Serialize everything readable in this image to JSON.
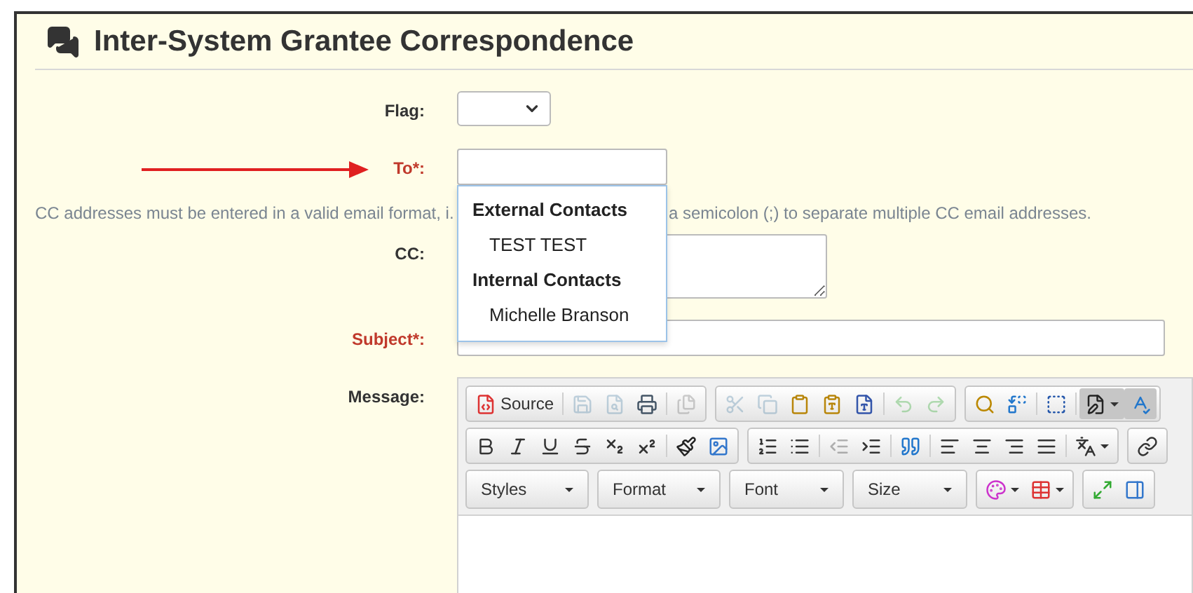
{
  "page": {
    "title": "Inter-System Grantee Correspondence"
  },
  "fields": [
    {
      "kind": "select",
      "label": "Flag:",
      "required": false
    },
    {
      "kind": "combo",
      "label": "To*:",
      "required": true,
      "pointer": true,
      "expanded": true,
      "options": [
        {
          "kind": "group",
          "label": "External Contacts"
        },
        {
          "kind": "option",
          "label": "TEST TEST"
        },
        {
          "kind": "group",
          "label": "Internal Contacts"
        },
        {
          "kind": "option",
          "label": "Michelle Branson"
        }
      ]
    },
    {
      "kind": "hint",
      "parts": [
        "CC addresses must be entered in a valid email format, i.",
        "a semicolon (;) to separate multiple CC email addresses."
      ]
    },
    {
      "kind": "textarea",
      "label": "CC:",
      "required": false
    },
    {
      "kind": "input",
      "label": "Subject*:",
      "required": true
    },
    {
      "kind": "editor",
      "label": "Message:",
      "required": false,
      "toolbar": [
        [
          [
            [
              {
                "kind": "source",
                "label": "Source",
                "disabled": false,
                "pressed": false,
                "menu": false
              }
            ],
            [
              {
                "kind": "save",
                "disabled": true,
                "pressed": false,
                "menu": false
              },
              {
                "kind": "preview",
                "disabled": true,
                "pressed": false,
                "menu": false
              },
              {
                "kind": "print",
                "disabled": false,
                "pressed": false,
                "menu": false
              }
            ],
            [
              {
                "kind": "templates",
                "disabled": true,
                "pressed": false,
                "menu": false
              }
            ]
          ],
          [
            [
              {
                "kind": "cut",
                "disabled": true,
                "pressed": false,
                "menu": false
              },
              {
                "kind": "copy",
                "disabled": true,
                "pressed": false,
                "menu": false
              },
              {
                "kind": "paste",
                "disabled": false,
                "pressed": false,
                "menu": false
              },
              {
                "kind": "paste-text",
                "disabled": false,
                "pressed": false,
                "menu": false
              },
              {
                "kind": "paste-word",
                "disabled": false,
                "pressed": false,
                "menu": false
              }
            ],
            [
              {
                "kind": "undo",
                "disabled": true,
                "pressed": false,
                "menu": false
              },
              {
                "kind": "redo",
                "disabled": true,
                "pressed": false,
                "menu": false
              }
            ]
          ],
          [
            [
              {
                "kind": "find",
                "disabled": false,
                "pressed": false,
                "menu": false
              },
              {
                "kind": "replace",
                "disabled": false,
                "pressed": false,
                "menu": false
              }
            ],
            [
              {
                "kind": "select-all",
                "disabled": false,
                "pressed": false,
                "menu": false
              }
            ],
            [
              {
                "kind": "format-dropdown",
                "disabled": false,
                "pressed": true,
                "menu": true
              },
              {
                "kind": "spellcheck",
                "disabled": false,
                "pressed": true,
                "menu": false
              }
            ]
          ]
        ],
        [
          [
            [
              {
                "kind": "bold",
                "disabled": false,
                "pressed": false,
                "menu": false
              },
              {
                "kind": "italic",
                "disabled": false,
                "pressed": false,
                "menu": false
              },
              {
                "kind": "underline",
                "disabled": false,
                "pressed": false,
                "menu": false
              },
              {
                "kind": "strike",
                "disabled": false,
                "pressed": false,
                "menu": false
              },
              {
                "kind": "subscript",
                "disabled": false,
                "pressed": false,
                "menu": false
              },
              {
                "kind": "superscript",
                "disabled": false,
                "pressed": false,
                "menu": false
              }
            ],
            [
              {
                "kind": "brush",
                "disabled": false,
                "pressed": false,
                "menu": false
              },
              {
                "kind": "image",
                "disabled": false,
                "pressed": false,
                "menu": false
              }
            ]
          ],
          [
            [
              {
                "kind": "ordered-list",
                "disabled": false,
                "pressed": false,
                "menu": false
              },
              {
                "kind": "bullet-list",
                "disabled": false,
                "pressed": false,
                "menu": false
              }
            ],
            [
              {
                "kind": "outdent",
                "disabled": true,
                "pressed": false,
                "menu": false
              },
              {
                "kind": "indent",
                "disabled": false,
                "pressed": false,
                "menu": false
              }
            ],
            [
              {
                "kind": "blockquote",
                "disabled": false,
                "pressed": false,
                "menu": false
              }
            ],
            [
              {
                "kind": "align-left",
                "disabled": false,
                "pressed": false,
                "menu": false
              },
              {
                "kind": "align-center",
                "disabled": false,
                "pressed": false,
                "menu": false
              },
              {
                "kind": "align-right",
                "disabled": false,
                "pressed": false,
                "menu": false
              },
              {
                "kind": "align-justify",
                "disabled": false,
                "pressed": false,
                "menu": false
              }
            ],
            [
              {
                "kind": "language",
                "disabled": false,
                "pressed": false,
                "menu": true
              }
            ]
          ],
          [
            [
              {
                "kind": "link",
                "disabled": false,
                "pressed": false,
                "menu": false
              }
            ]
          ]
        ],
        [
          [
            [
              {
                "kind": "combo",
                "label": "Styles",
                "disabled": false,
                "pressed": false,
                "menu": true
              }
            ]
          ],
          [
            [
              {
                "kind": "combo",
                "label": "Format",
                "disabled": false,
                "pressed": false,
                "menu": true
              }
            ]
          ],
          [
            [
              {
                "kind": "combo",
                "label": "Font",
                "disabled": false,
                "pressed": false,
                "menu": true
              }
            ]
          ],
          [
            [
              {
                "kind": "combo",
                "label": "Size",
                "disabled": false,
                "pressed": false,
                "menu": true
              }
            ]
          ],
          [
            [
              {
                "kind": "text-color",
                "disabled": false,
                "pressed": false,
                "menu": true
              },
              {
                "kind": "table",
                "disabled": false,
                "pressed": false,
                "menu": true
              }
            ]
          ],
          [
            [
              {
                "kind": "maximize",
                "disabled": false,
                "pressed": false,
                "menu": false
              },
              {
                "kind": "show-blocks",
                "disabled": false,
                "pressed": false,
                "menu": false
              }
            ]
          ]
        ]
      ]
    }
  ]
}
